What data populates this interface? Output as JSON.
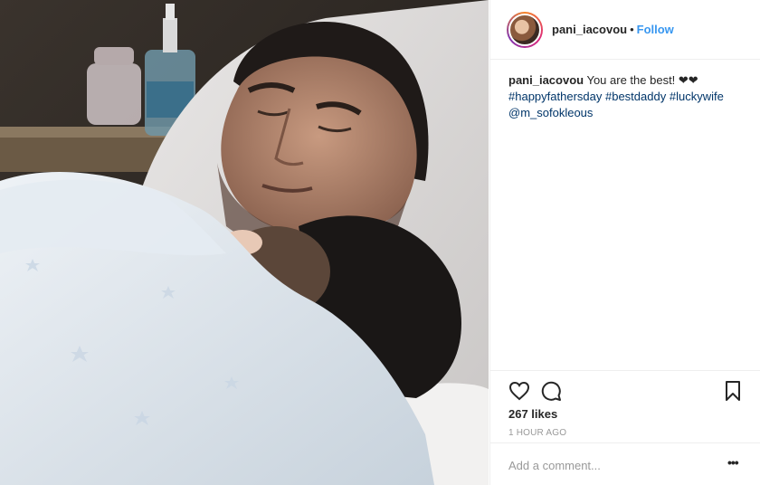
{
  "post": {
    "username": "pani_iacovou",
    "separator": "•",
    "follow_label": "Follow",
    "caption_user": "pani_iacovou",
    "caption_text": "You are the best! ❤❤",
    "hashtags": [
      "#happyfathersday",
      "#bestdaddy",
      "#luckywife"
    ],
    "mention": "@m_sofokleous",
    "likes": "267 likes",
    "time_ago": "1 HOUR AGO",
    "comment_placeholder": "Add a comment...",
    "more_label": "•••"
  },
  "icons": {
    "like": "heart-icon",
    "comment": "comment-icon",
    "save": "bookmark-icon",
    "more": "more-options-icon"
  },
  "colors": {
    "follow": "#3897f0",
    "hashtag": "#003569",
    "text": "#262626",
    "muted": "#999999"
  }
}
